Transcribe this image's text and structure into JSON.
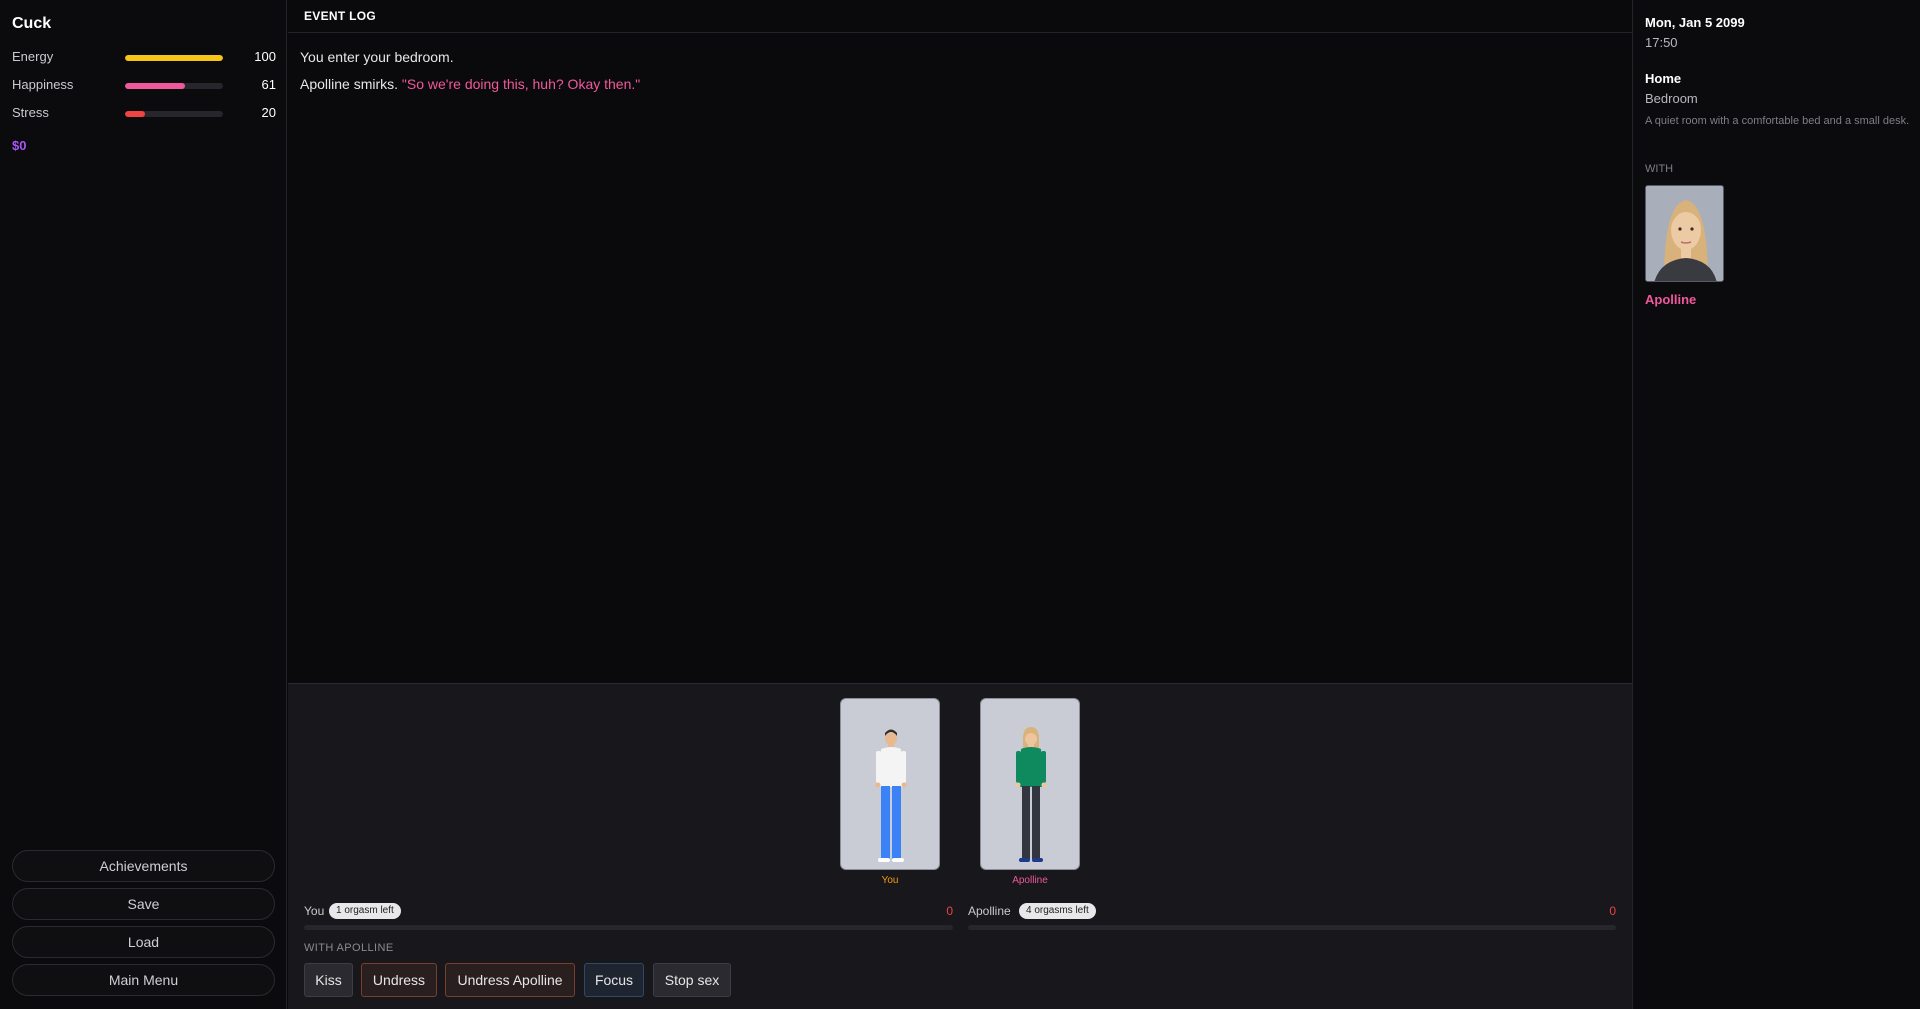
{
  "player": {
    "name": "Cuck",
    "stats": [
      {
        "label": "Energy",
        "value": "100",
        "level": 1.0,
        "color": "#f5c518"
      },
      {
        "label": "Happiness",
        "value": "61",
        "level": 0.61,
        "color": "#f0589d"
      },
      {
        "label": "Stress",
        "value": "20",
        "level": 0.2,
        "color": "#ef4444"
      }
    ],
    "money": "$0"
  },
  "menu": {
    "achievements": "Achievements",
    "save": "Save",
    "load": "Load",
    "main_menu": "Main Menu"
  },
  "log": {
    "title": "EVENT LOG",
    "line1": "You enter your bedroom.",
    "line2_prefix": "Apolline smirks. ",
    "line2_quote": "\"So we're doing this, huh? Okay then.\""
  },
  "scene": {
    "you_label": "You",
    "partner_label": "Apolline",
    "you_meter": {
      "name": "You",
      "pill": "1 orgasm left",
      "count": "0",
      "level": 0
    },
    "partner_meter": {
      "name": "Apolline",
      "pill": "4 orgasms left",
      "count": "0",
      "level": 0
    },
    "with_label": "WITH APOLLINE",
    "actions": [
      "Kiss",
      "Undress",
      "Undress Apolline",
      "Focus",
      "Stop sex"
    ]
  },
  "info": {
    "date": "Mon, Jan 5 2099",
    "time": "17:50",
    "location": "Home",
    "room": "Bedroom",
    "description": "A quiet room with a comfortable bed and a small desk.",
    "with_title": "WITH",
    "companion": "Apolline"
  }
}
